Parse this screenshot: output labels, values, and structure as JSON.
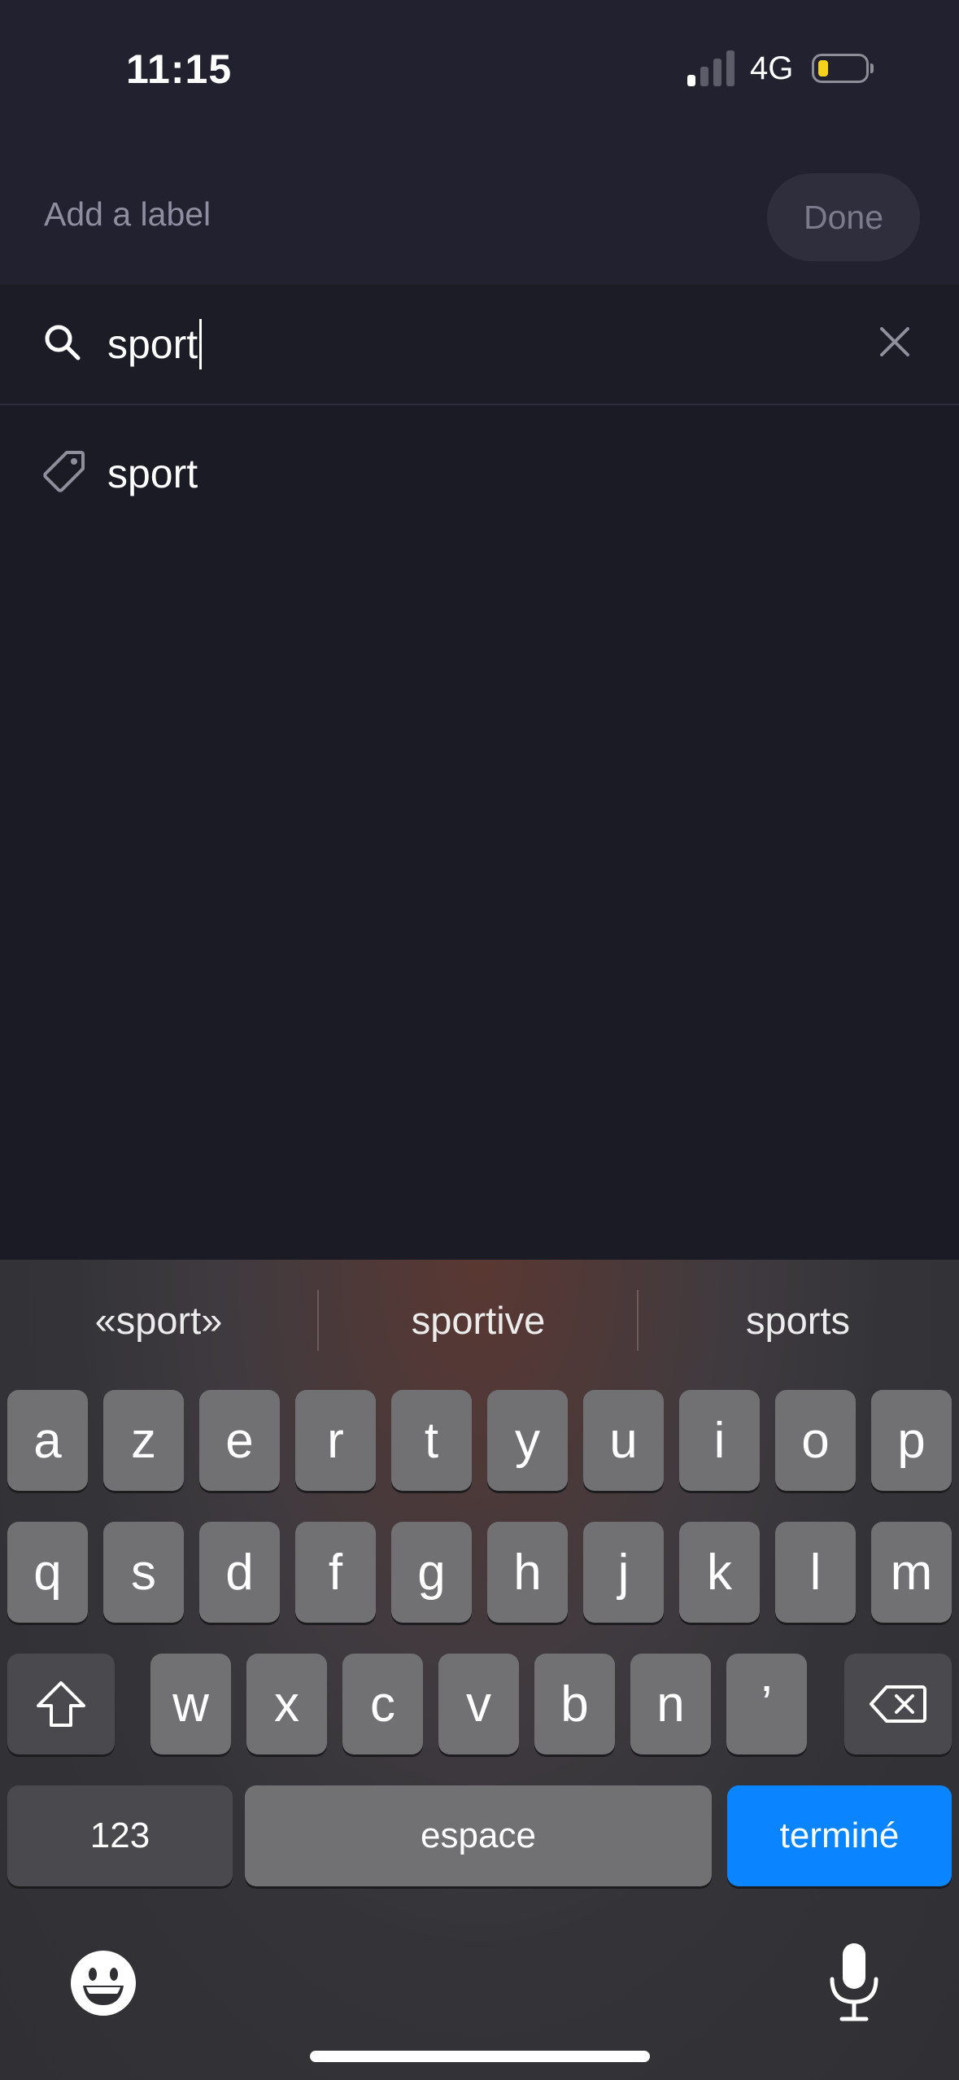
{
  "status_bar": {
    "time": "11:15",
    "network": "4G",
    "signal_bars_filled": 1,
    "signal_bars_total": 4,
    "battery_color": "#f4d21d"
  },
  "header": {
    "title_placeholder": "Add a label",
    "done_label": "Done"
  },
  "search": {
    "value": "sport",
    "icon": "search-icon",
    "clear_icon": "close-icon"
  },
  "results": [
    {
      "label": "sport",
      "icon": "tag-icon"
    }
  ],
  "keyboard": {
    "suggestions": [
      "«sport»",
      "sportive",
      "sports"
    ],
    "row1": [
      "a",
      "z",
      "e",
      "r",
      "t",
      "y",
      "u",
      "i",
      "o",
      "p"
    ],
    "row2": [
      "q",
      "s",
      "d",
      "f",
      "g",
      "h",
      "j",
      "k",
      "l",
      "m"
    ],
    "row3": [
      "w",
      "x",
      "c",
      "v",
      "b",
      "n",
      "’"
    ],
    "numbers_label": "123",
    "space_label": "espace",
    "return_label": "terminé",
    "return_color": "#0a84ff"
  }
}
